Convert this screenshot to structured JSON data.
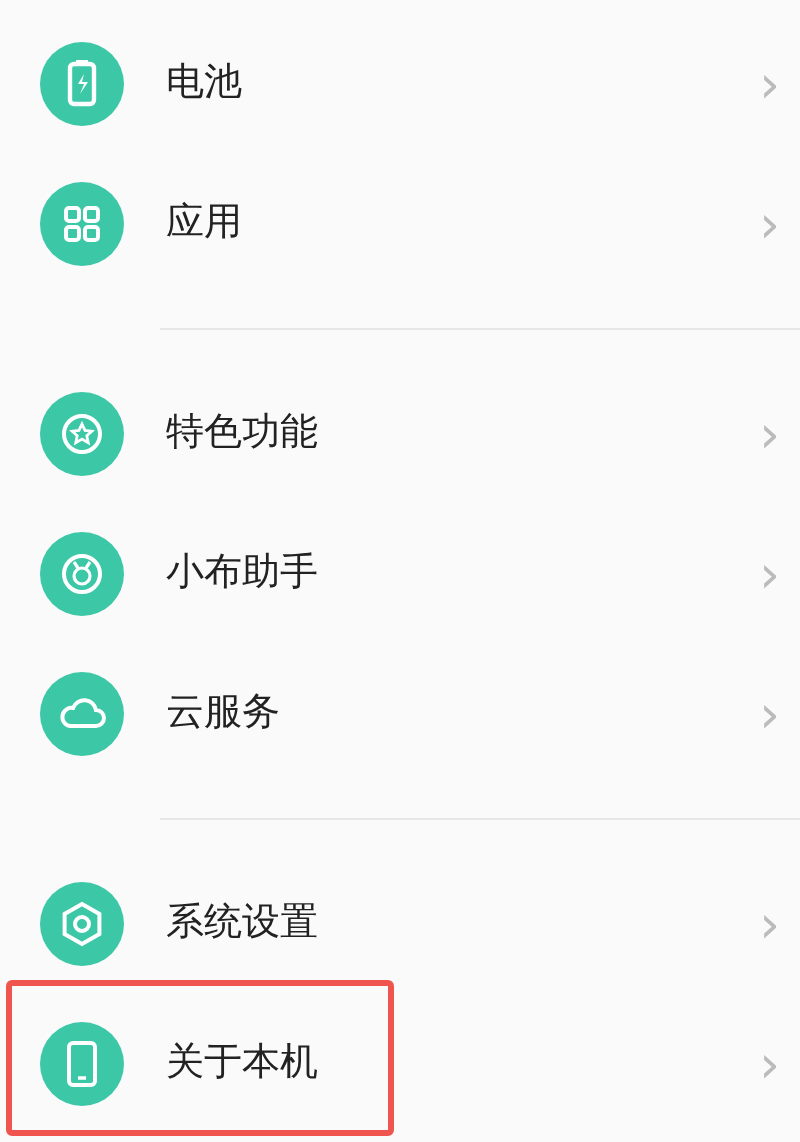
{
  "groups": [
    {
      "items": [
        {
          "kind": "battery",
          "label": "电池",
          "chevron": "›",
          "highlighted": false
        },
        {
          "kind": "apps",
          "label": "应用",
          "chevron": "›",
          "highlighted": false
        }
      ]
    },
    {
      "items": [
        {
          "kind": "star",
          "label": "特色功能",
          "chevron": "›",
          "highlighted": false
        },
        {
          "kind": "assistant",
          "label": "小布助手",
          "chevron": "›",
          "highlighted": false
        },
        {
          "kind": "cloud",
          "label": "云服务",
          "chevron": "›",
          "highlighted": false
        }
      ]
    },
    {
      "items": [
        {
          "kind": "settings",
          "label": "系统设置",
          "chevron": "›",
          "highlighted": false
        },
        {
          "kind": "phone",
          "label": "关于本机",
          "chevron": "›",
          "highlighted": true
        }
      ]
    }
  ]
}
